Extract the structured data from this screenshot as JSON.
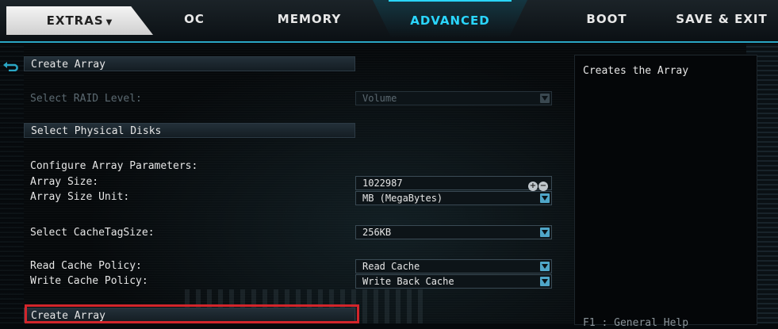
{
  "nav": {
    "extras": "EXTRAS",
    "extras_caret": "▼",
    "oc": "OC",
    "memory": "MEMORY",
    "advanced": "ADVANCED",
    "boot": "BOOT",
    "save_exit": "SAVE & EXIT"
  },
  "menu": {
    "create_array_header": "Create Array",
    "raid_level_label": "Select RAID Level:",
    "raid_level_value": "Volume",
    "physical_disks": "Select Physical Disks",
    "params_heading": "Configure Array Parameters:",
    "array_size_label": "Array Size:",
    "array_size_value": "1022987",
    "array_size_unit_label": "Array Size Unit:",
    "array_size_unit_value": "MB (MegaBytes)",
    "cachetag_label": "Select CacheTagSize:",
    "cachetag_value": "256KB",
    "read_cache_label": "Read Cache Policy:",
    "read_cache_value": "Read Cache",
    "write_cache_label": "Write Cache Policy:",
    "write_cache_value": "Write Back Cache",
    "create_array_action": "Create Array"
  },
  "stepper": {
    "plus": "+",
    "minus": "−"
  },
  "help": {
    "description": "Creates the Array",
    "hint": "F1   : General Help"
  },
  "colors": {
    "accent": "#2ad6ff",
    "selection": "#d2252b",
    "dropdown_arrow": "#4fa6c8"
  },
  "icons": {
    "back": "back-arrow-icon",
    "dropdown": "chevron-down-icon",
    "increment": "plus-icon",
    "decrement": "minus-icon"
  }
}
